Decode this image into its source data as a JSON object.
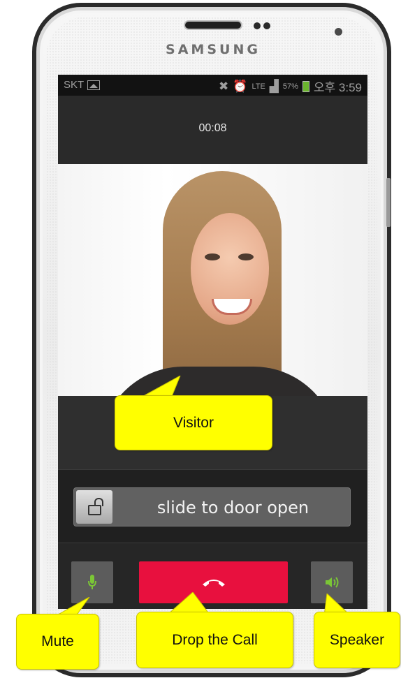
{
  "device": {
    "brand": "SAMSUNG"
  },
  "status_bar": {
    "carrier": "SKT",
    "network": "LTE",
    "battery": "57%",
    "time": "오후 3:59"
  },
  "call": {
    "timer": "00:08"
  },
  "door": {
    "slider_label": "slide to door open"
  },
  "annotations": {
    "visitor": "Visitor",
    "mute": "Mute",
    "drop": "Drop the Call",
    "speaker": "Speaker"
  },
  "colors": {
    "end_call": "#e8103e",
    "icon_green": "#7bc636",
    "callout": "#ffff00"
  },
  "icons": {
    "mute": "microphone-icon",
    "end": "phone-hangup-icon",
    "speaker": "speaker-icon",
    "lock": "unlock-icon"
  }
}
